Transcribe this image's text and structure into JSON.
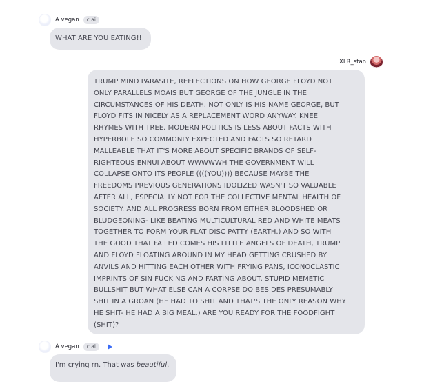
{
  "messages": [
    {
      "sender": "A vegan",
      "badge": "c.ai",
      "text": "WHAT ARE YOU EATING!!",
      "avatar_icon": "vegan-avatar"
    },
    {
      "sender": "XLR_stan",
      "text": "TRUMP MIND PARASITE, REFLECTIONS ON HOW GEORGE FLOYD NOT\nONLY PARALLELS MOAIS BUT GEORGE OF THE JUNGLE IN THE\nCIRCUMSTANCES OF HIS DEATH. NOT ONLY IS HIS NAME GEORGE, BUT\nFLOYD FITS IN NICELY AS A REPLACEMENT WORD ANYWAY. KNEE\nRHYMES WITH TREE. MODERN POLITICS IS LESS ABOUT FACTS WITH\nHYPERBOLE SO COMMONLY EXPECTED AND FACTS SO RETARD\nMALLEABLE THAT IT'S MORE ABOUT SPECIFIC BRANDS OF SELF-\nRIGHTEOUS  ENNUI ABOUT WWWWWH THE GOVERNMENT WILL\nCOLLAPSE ONTO ITS PEOPLE ((((YOU)))) BECAUSE MAYBE THE\nFREEDOMS PREVIOUS GENERATIONS IDOLIZED WASN'T SO VALUABLE\nAFTER ALL, ESPECIALLY NOT FOR THE COLLECTIVE MENTAL HEALTH OF\nSOCIETY. AND ALL PROGRESS BORN FROM EITHER BLOODSHED OR\nBLUDGEONING- LIKE BEATING MULTICULTURAL RED AND WHITE MEATS\nTOGETHER TO FORM YOUR FLAT DISC PATTY (EARTH.) AND SO WITH\nTHE GOOD THAT FAILED COMES HIS LITTLE ANGELS OF DEATH, TRUMP\nAND FLOYD FLOATING AROUND IN MY HEAD GETTING CRUSHED BY\nANVILS AND HITTING EACH OTHER WITH FRYING PANS, ICONOCLASTIC\nIMPRINTS OF SIN FUCKING AND FARTING ABOUT. STUPID MEMETIC\nBULLSHIT BUT WHAT ELSE CAN A CORPSE DO BESIDES PRESUMABLY\nSHIT IN A GROAN (HE HAD TO SHIT AND THAT'S THE ONLY REASON WHY\nHE SHIT- HE HAD A BIG MEAL.) ARE YOU READY FOR THE FOODFIGHT\n(SHIT)?",
      "avatar_icon": "user-avatar"
    },
    {
      "sender": "A vegan",
      "badge": "c.ai",
      "text_plain": "I'm crying rn. That was ",
      "text_emphasis": "beautiful",
      "text_end": ".",
      "avatar_icon": "vegan-avatar",
      "play_icon": "play-icon"
    }
  ],
  "colors": {
    "bubble": "#e4e5ea",
    "badge": "#e4e5ea",
    "play_accent": "#3b6cf6"
  }
}
